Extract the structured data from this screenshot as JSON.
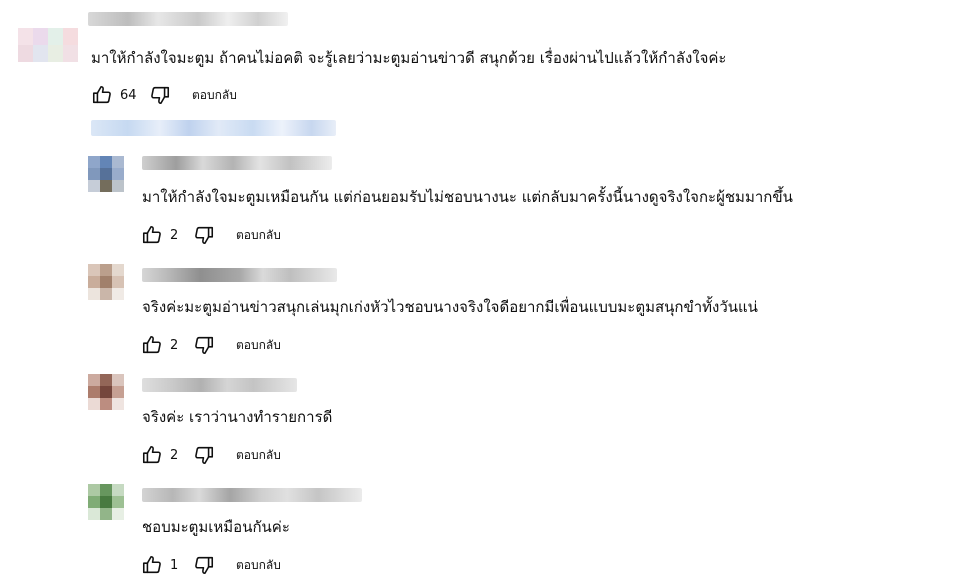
{
  "top_comment": {
    "text": "มาให้กำลังใจมะตูม ถ้าคนไม่อคติ จะรู้เลยว่ามะตูมอ่านข่าวดี สนุกด้วย เรื่องผ่านไปแล้วให้กำลังใจค่ะ",
    "like_count": "64",
    "reply_label": "ตอบกลับ"
  },
  "replies": [
    {
      "text": "มาให้กำลังใจมะตูมเหมือนกัน แต่ก่อนยอมรับไม่ชอบนางนะ แต่กลับมาครั้งนี้นางดูจริงใจกะผู้ชมมากขึ้น",
      "like_count": "2",
      "reply_label": "ตอบกลับ"
    },
    {
      "text": "จริงค่ะมะตูมอ่านข่าวสนุกเล่นมุกเก่งหัวไวชอบนางจริงใจดีอยากมีเพื่อนแบบมะตูมสนุกขำทั้งวันแน่",
      "like_count": "2",
      "reply_label": "ตอบกลับ"
    },
    {
      "text": "จริงค่ะ เราว่านางทำรายการดี",
      "like_count": "2",
      "reply_label": "ตอบกลับ"
    },
    {
      "text": "ชอบมะตูมเหมือนกันค่ะ",
      "like_count": "1",
      "reply_label": "ตอบกลับ"
    }
  ],
  "icons": {
    "like": "thumb-up-icon",
    "dislike": "thumb-down-icon"
  }
}
